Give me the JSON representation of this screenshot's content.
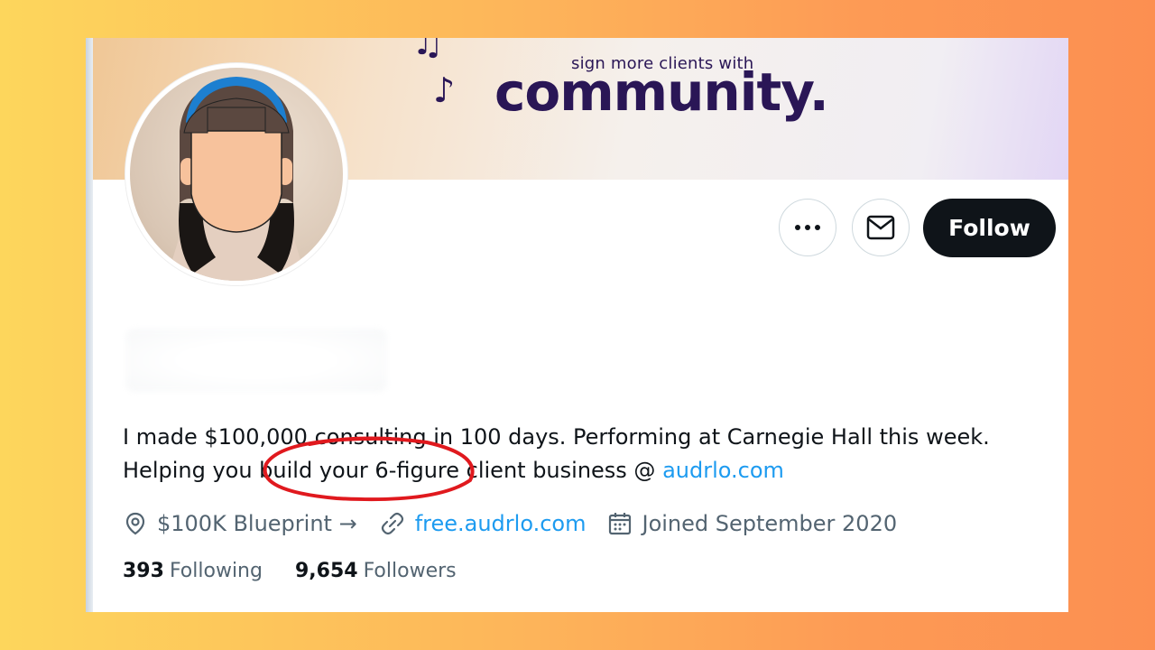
{
  "banner": {
    "tagline": "sign more clients with",
    "title": "community."
  },
  "profile": {
    "avatar_icon": "avatar-cartoon-face-icon",
    "bio_text": "I made $100,000 consulting in 100 days. Performing at Carnegie Hall this week. Helping you build your 6-figure client business @ ",
    "bio_link": "audrlo.com",
    "location": "$100K Blueprint →",
    "website": "free.audrlo.com",
    "joined": "Joined September 2020"
  },
  "actions": {
    "more_icon": "more-options-icon",
    "message_icon": "envelope-icon",
    "follow_label": "Follow"
  },
  "stats": {
    "following_count": "393",
    "following_label": "Following",
    "followers_count": "9,654",
    "followers_label": "Followers"
  },
  "colors": {
    "link": "#1d9bf0",
    "follow_button_bg": "#0f1419",
    "banner_text": "#2a1656",
    "annotation": "#e0191e"
  }
}
